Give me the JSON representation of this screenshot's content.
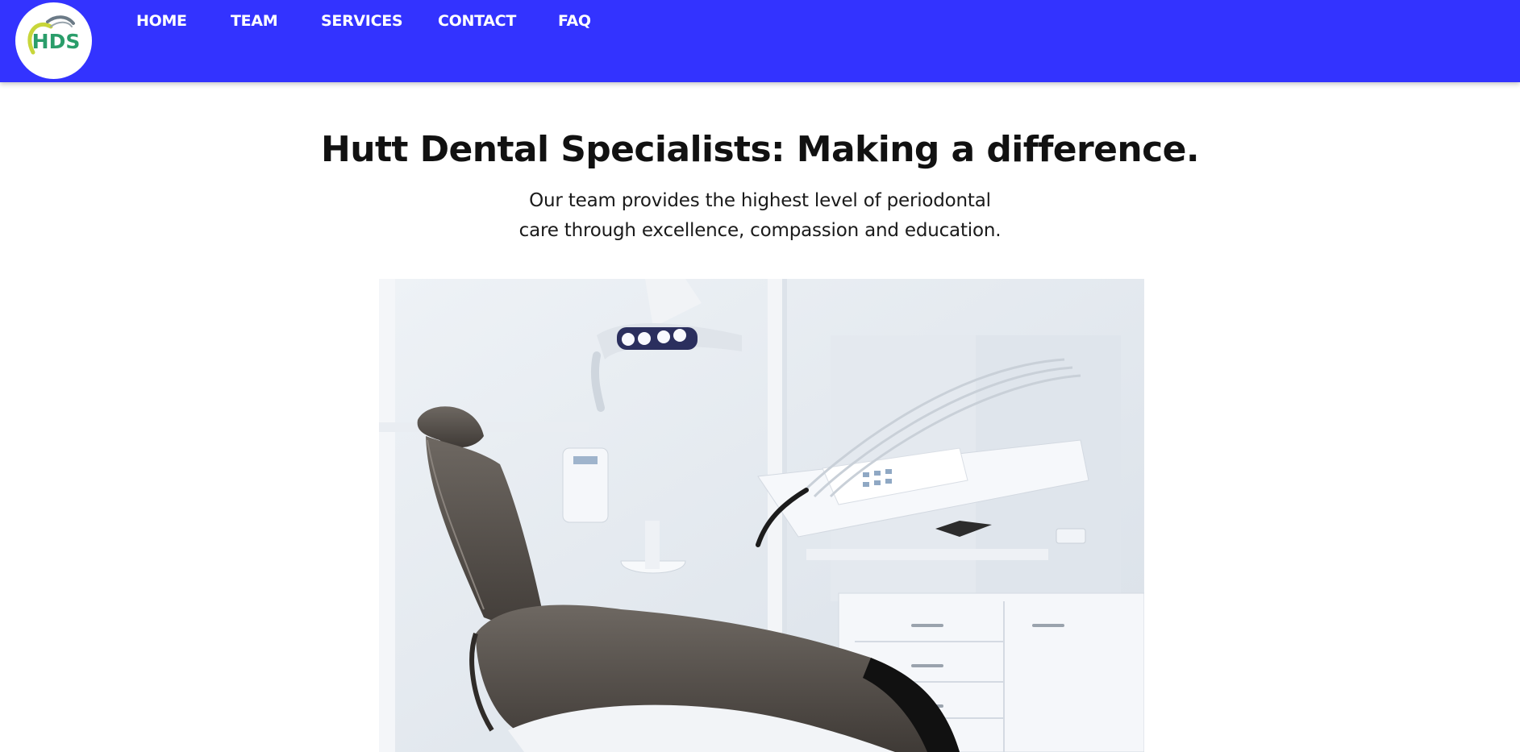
{
  "header": {
    "background_color": "#3333ff",
    "logo": {
      "text": "HDS",
      "icon": "tooth-arc-logo"
    },
    "nav": [
      {
        "label": "HOME"
      },
      {
        "label": "TEAM"
      },
      {
        "label": "SERVICES"
      },
      {
        "label": "CONTACT"
      },
      {
        "label": "FAQ"
      }
    ]
  },
  "hero": {
    "title": "Hutt Dental Specialists: Making a difference.",
    "subtitle_line1": "Our team provides the highest level of periodontal",
    "subtitle_line2": "care through excellence, compassion and education.",
    "image": "dental-chair-photo"
  }
}
